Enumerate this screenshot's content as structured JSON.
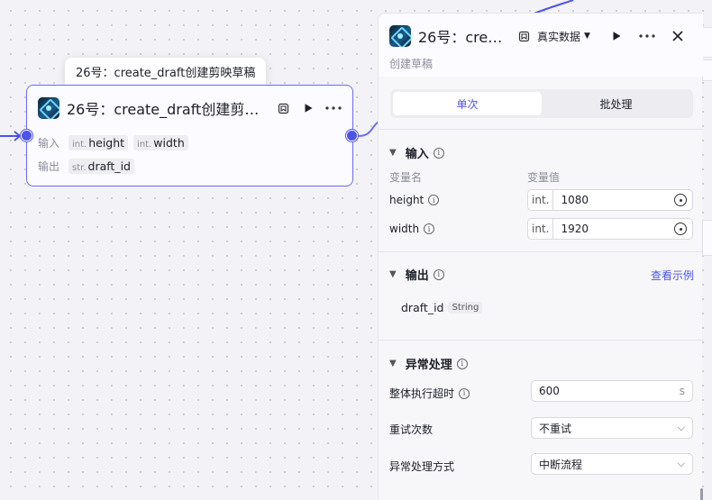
{
  "tooltip": {
    "text": "26号：create_draft创建剪映草稿"
  },
  "node": {
    "title": "26号：create_draft创建剪映草稿",
    "input_label": "输入",
    "output_label": "输出",
    "inputs": [
      {
        "type": "int.",
        "name": "height"
      },
      {
        "type": "int.",
        "name": "width"
      }
    ],
    "outputs": [
      {
        "type": "str.",
        "name": "draft_id"
      }
    ]
  },
  "panel": {
    "title": "26号：create_draft创建剪映草稿",
    "mode_label": "真实数据",
    "subtitle": "创建草稿",
    "tabs": [
      {
        "label": "单次",
        "active": true
      },
      {
        "label": "批处理",
        "active": false
      }
    ],
    "input_section": {
      "title": "输入",
      "col_name": "变量名",
      "col_value": "变量值",
      "params": [
        {
          "name": "height",
          "type": "int.",
          "value": "1080"
        },
        {
          "name": "width",
          "type": "int.",
          "value": "1920"
        }
      ]
    },
    "output_section": {
      "title": "输出",
      "example_link": "查看示例",
      "vars": [
        {
          "name": "draft_id",
          "type": "String"
        }
      ]
    },
    "error_section": {
      "title": "异常处理",
      "timeout_label": "整体执行超时",
      "timeout_value": "600",
      "timeout_unit": "s",
      "retry_label": "重试次数",
      "retry_value": "不重试",
      "method_label": "异常处理方式",
      "method_value": "中断流程"
    }
  },
  "colors": {
    "accent": "#4d53e8",
    "node_border": "#6b6af0"
  },
  "icons": [
    "app-logo-icon",
    "bookmark-icon",
    "play-icon",
    "more-icon",
    "close-icon",
    "info-icon",
    "chevron-down-icon",
    "variable-ref-icon"
  ]
}
